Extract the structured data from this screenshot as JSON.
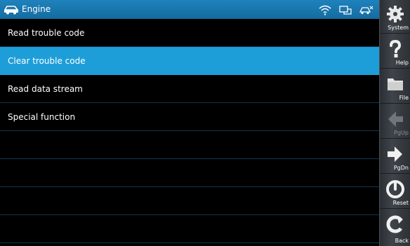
{
  "titlebar": {
    "title": "Engine",
    "app_icon": "car-icon",
    "status_icons": [
      "wifi-icon",
      "vci-link-icon",
      "vehicle-connection-icon"
    ]
  },
  "menu": {
    "items": [
      {
        "label": "Read trouble code",
        "selected": false
      },
      {
        "label": "Clear trouble code",
        "selected": true
      },
      {
        "label": "Read data stream",
        "selected": false
      },
      {
        "label": "Special function",
        "selected": false
      },
      {
        "label": "",
        "selected": false
      },
      {
        "label": "",
        "selected": false
      },
      {
        "label": "",
        "selected": false
      },
      {
        "label": "",
        "selected": false
      }
    ]
  },
  "sidebar": {
    "buttons": [
      {
        "label": "System",
        "icon": "gear-icon",
        "enabled": true
      },
      {
        "label": "Help",
        "icon": "question-mark-icon",
        "enabled": true
      },
      {
        "label": "File",
        "icon": "folder-icon",
        "enabled": true
      },
      {
        "label": "PgUp",
        "icon": "arrow-left-icon",
        "enabled": false
      },
      {
        "label": "PgDn",
        "icon": "arrow-right-icon",
        "enabled": true
      },
      {
        "label": "Reset",
        "icon": "reset-icon",
        "enabled": true
      },
      {
        "label": "Back",
        "icon": "back-icon",
        "enabled": true
      }
    ]
  },
  "colors": {
    "titlebar": "#1a78b0",
    "selected_row": "#1e9ed9",
    "background": "#000000",
    "divider": "#0f3552"
  }
}
